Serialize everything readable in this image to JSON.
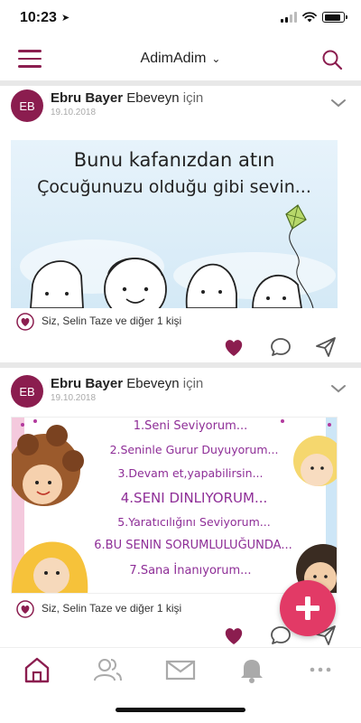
{
  "status": {
    "time": "10:23",
    "battery_level": 0.85
  },
  "nav": {
    "title": "AdimAdim"
  },
  "posts": [
    {
      "avatar": "EB",
      "author": "Ebru Bayer",
      "audience": "Ebeveyn",
      "for_word": "için",
      "date": "19.10.2018",
      "image_lines": [
        "Bunu kafanızdan atın",
        "Çocuğunuzu olduğu gibi sevin..."
      ],
      "likes_text": "Siz, Selin Taze ve diğer 1 kişi",
      "liked": true
    },
    {
      "avatar": "EB",
      "author": "Ebru Bayer",
      "audience": "Ebeveyn",
      "for_word": "için",
      "date": "19.10.2018",
      "image_lines": [
        "1.Seni Seviyorum...",
        "2.Seninle Gurur Duyuyorum...",
        "3.Devam et,yapabilirsin...",
        "4.SENI DINLIYORUM...",
        "5.Yaratıcılığını Seviyorum...",
        "6.BU SENIN SORUMLULUĞUNDA...",
        "7.Sana İnanıyorum..."
      ],
      "likes_text": "Siz, Selin Taze ve diğer 1 kişi",
      "liked": true
    }
  ],
  "tabs": [
    "home-icon",
    "people-icon",
    "mail-icon",
    "bell-icon",
    "more-icon"
  ],
  "colors": {
    "brand": "#8b1d4f",
    "fab": "#e23a66",
    "kite": "#b7d86a"
  }
}
